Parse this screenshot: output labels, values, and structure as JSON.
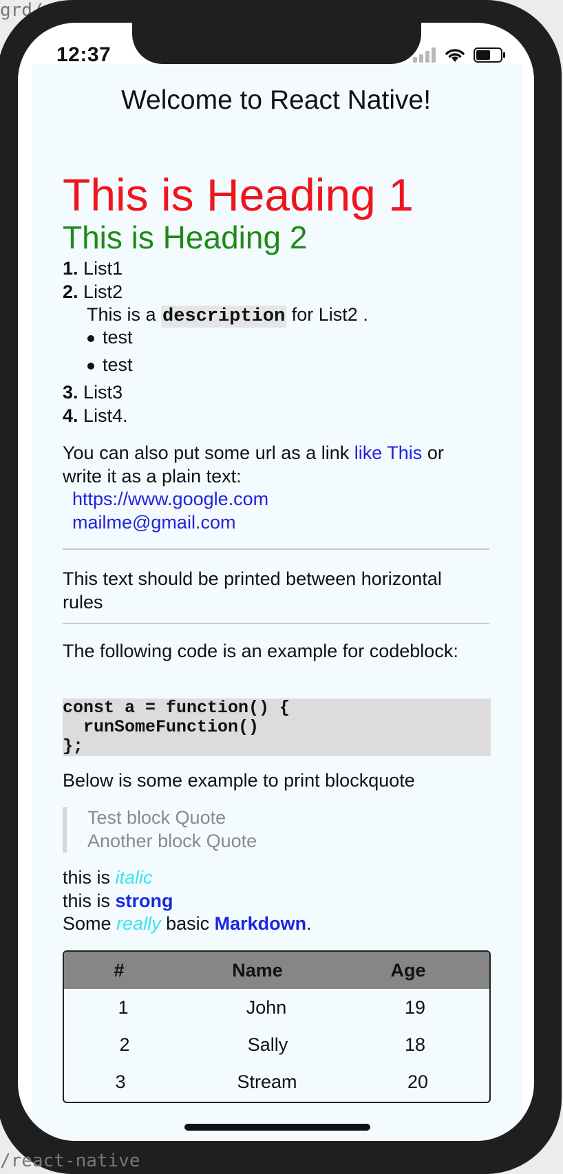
{
  "background": {
    "top_text": "grd/",
    "bottom_text": "/react-native"
  },
  "status": {
    "time": "12:37",
    "icons": [
      "signal-icon",
      "wifi-icon",
      "battery-icon"
    ]
  },
  "app": {
    "title": "Welcome to React Native!"
  },
  "markdown": {
    "h1": "This is Heading 1",
    "h2": "This is Heading 2",
    "list": [
      {
        "num": "1.",
        "text": "List1"
      },
      {
        "num": "2.",
        "text": "List2"
      },
      {
        "num": "3.",
        "text": "List3"
      },
      {
        "num": "4.",
        "text": "List4."
      }
    ],
    "description": {
      "before": "This is a",
      "code": "description",
      "after": " for List2 ."
    },
    "bullets": [
      "test",
      "test"
    ],
    "link_paragraph": {
      "before": "You can also put some url as a link",
      "link": "like This",
      "after": "or",
      "line2": "write it as a plain text:"
    },
    "urls": [
      "https://www.google.com",
      "mailme@gmail.com"
    ],
    "hr_text": {
      "line1": "This text should be printed between horizontal",
      "line2": "rules"
    },
    "code_intro": "The following code is an example for codeblock:",
    "code_lines": [
      "const a = function() {",
      "  runSomeFunction()",
      "};"
    ],
    "quote_intro": "Below is some example to print blockquote",
    "quotes": [
      "Test block Quote",
      "Another  block Quote"
    ],
    "emphasis": {
      "line1_prefix": "this is ",
      "line1_em": "italic",
      "line2_prefix": "this is ",
      "line2_strong": "strong",
      "line3_a": "Some ",
      "line3_em": "really",
      "line3_b": " basic ",
      "line3_strong": "Markdown",
      "line3_c": "."
    },
    "table": {
      "headers": [
        "#",
        "Name",
        "Age"
      ],
      "rows": [
        [
          "1",
          "John",
          "19"
        ],
        [
          "2",
          "Sally",
          "18"
        ],
        [
          "3",
          "Stream",
          "20"
        ]
      ]
    }
  },
  "colors": {
    "h1": "#f0141e",
    "h2": "#1f8a17",
    "link": "#2222dd",
    "italic": "#3ae4ee",
    "strong": "#1a27e0",
    "table_header": "#868686"
  }
}
